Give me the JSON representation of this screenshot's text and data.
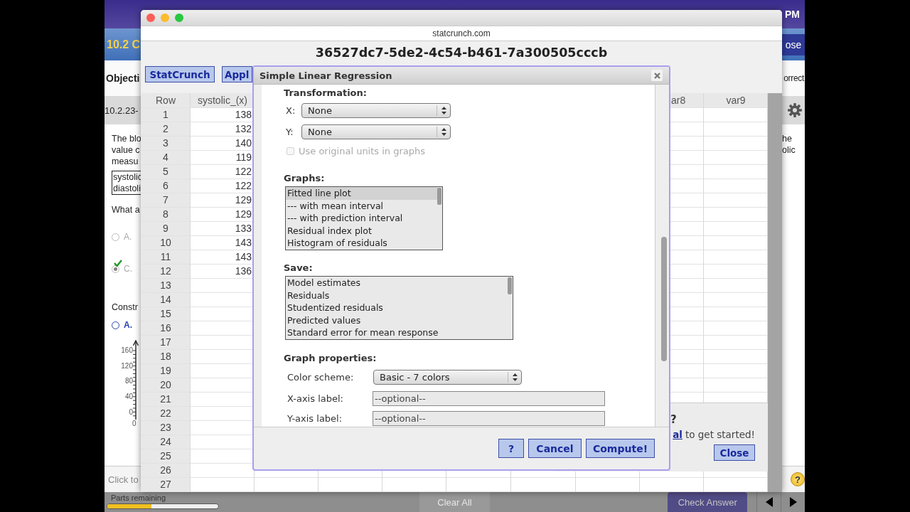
{
  "background_app": {
    "clock": "PM",
    "assignment_title": "10.2 C",
    "close_button": "ose",
    "objective": "Objecti",
    "status": "orrect",
    "question_id": "10.2.23-",
    "question_text": [
      "The blo",
      "value c",
      "measu"
    ],
    "data_table": [
      "systolic",
      "diastoli"
    ],
    "question_text_right": [
      "he",
      "olic"
    ],
    "prompt": "What a",
    "choices": [
      {
        "label": "A.",
        "selected": false
      },
      {
        "label": "C.",
        "selected": true
      }
    ],
    "construct_prompt": "Constr",
    "graph_choice": {
      "label": "A.",
      "selected": false
    },
    "graph_axis_labels": [
      "160",
      "120",
      "80",
      "40",
      "0"
    ],
    "graph_origin": "0",
    "footer_hint": "Click to",
    "help": "?",
    "parts_label": "Parts remaining",
    "progress": {
      "level": 0.4
    },
    "clear_all": "Clear All",
    "check_answer": "Check Answer"
  },
  "browser": {
    "url": "statcrunch.com",
    "title": "36527dc7-5de2-4c54-b461-7a300505cccb",
    "toolbar": [
      "StatCrunch",
      "Appl"
    ],
    "grid": {
      "columns": [
        "Row",
        "systolic_(x)",
        "ar8",
        "var9"
      ],
      "rows": [
        {
          "row": "1",
          "systolic": "138"
        },
        {
          "row": "2",
          "systolic": "132"
        },
        {
          "row": "3",
          "systolic": "140"
        },
        {
          "row": "4",
          "systolic": "119"
        },
        {
          "row": "5",
          "systolic": "122"
        },
        {
          "row": "6",
          "systolic": "122"
        },
        {
          "row": "7",
          "systolic": "129"
        },
        {
          "row": "8",
          "systolic": "129"
        },
        {
          "row": "9",
          "systolic": "133"
        },
        {
          "row": "10",
          "systolic": "143"
        },
        {
          "row": "11",
          "systolic": "143"
        },
        {
          "row": "12",
          "systolic": "136"
        },
        {
          "row": "13"
        },
        {
          "row": "14"
        },
        {
          "row": "15"
        },
        {
          "row": "16"
        },
        {
          "row": "17"
        },
        {
          "row": "18"
        },
        {
          "row": "19"
        },
        {
          "row": "20"
        },
        {
          "row": "21"
        },
        {
          "row": "22"
        },
        {
          "row": "23"
        },
        {
          "row": "24"
        },
        {
          "row": "25"
        },
        {
          "row": "26"
        },
        {
          "row": "27"
        }
      ]
    },
    "help_panel": {
      "mark": "?",
      "link": "al",
      "text": "to get started!",
      "close_button": "Close"
    }
  },
  "dialog": {
    "title": "Simple Linear Regression",
    "transformation": {
      "heading": "Transformation:",
      "x": {
        "label": "X:",
        "value": "None"
      },
      "y": {
        "label": "Y:",
        "value": "None"
      },
      "original_units": {
        "label": "Use original units in graphs",
        "checked": false,
        "disabled": true
      }
    },
    "graphs": {
      "heading": "Graphs:",
      "items": [
        {
          "label": "Fitted line plot",
          "selected": true
        },
        {
          "label": "--- with mean interval",
          "selected": false
        },
        {
          "label": "--- with prediction interval",
          "selected": false
        },
        {
          "label": "Residual index plot",
          "selected": false
        },
        {
          "label": "Histogram of residuals",
          "selected": false
        }
      ]
    },
    "save": {
      "heading": "Save:",
      "items": [
        {
          "label": "Model estimates",
          "selected": false
        },
        {
          "label": "Residuals",
          "selected": false
        },
        {
          "label": "Studentized residuals",
          "selected": false
        },
        {
          "label": "Predicted values",
          "selected": false
        },
        {
          "label": "Standard error for mean response",
          "selected": false
        }
      ]
    },
    "graph_properties": {
      "heading": "Graph properties:",
      "fields": [
        {
          "kind": "select",
          "label": "Color scheme:",
          "value": "Basic - 7 colors"
        },
        {
          "kind": "text",
          "label": "X-axis label:",
          "placeholder": "--optional--"
        },
        {
          "kind": "text",
          "label": "Y-axis label:",
          "placeholder": "--optional--"
        }
      ]
    },
    "buttons": [
      "?",
      "Cancel",
      "Compute!"
    ]
  }
}
